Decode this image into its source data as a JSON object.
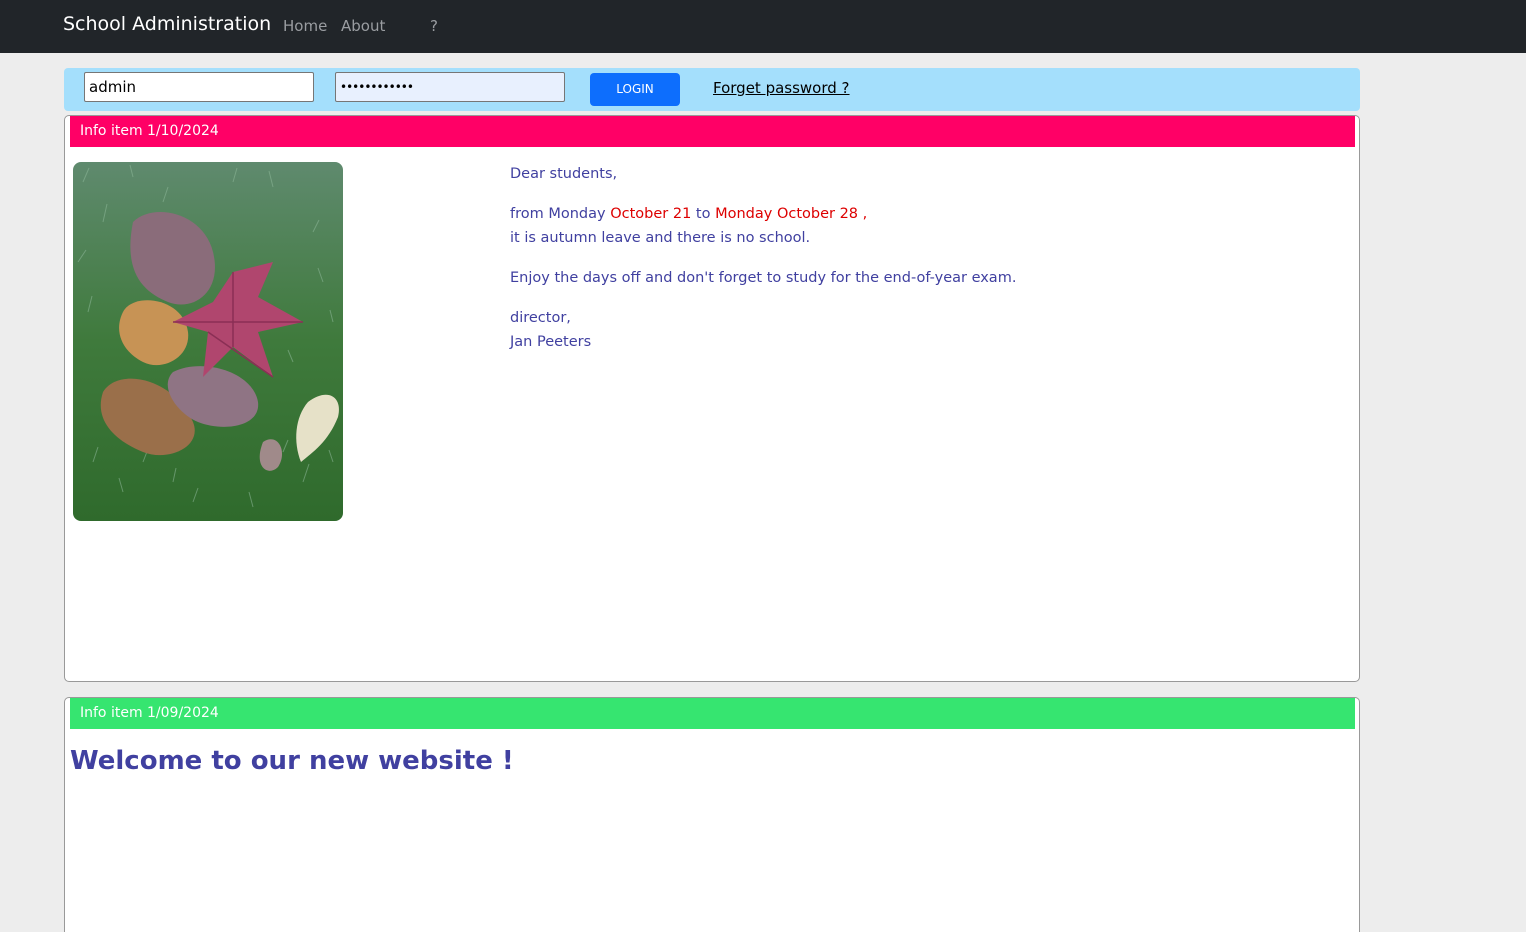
{
  "navbar": {
    "brand": "School Administration",
    "home": "Home",
    "about": "About",
    "help": "?"
  },
  "login": {
    "username_value": "admin",
    "password_mask": "••••••••••••",
    "login_label": "LOGIN",
    "forget_label": "Forget password ?"
  },
  "colors": {
    "navbar_bg": "#212529",
    "login_bar_bg": "#a4dffc",
    "login_button": "#0d6efd",
    "item1_header": "#ff0066",
    "item2_header": "#36e570",
    "text_blue": "#4040a0",
    "text_red": "#dd0000"
  },
  "items": [
    {
      "header": "Info item 1/10/2024",
      "greeting": "Dear students,",
      "line1_a": "from Monday",
      "line1_b": "October 21",
      "line1_c": "to",
      "line1_d": "Monday October 28",
      "line1_e": ",",
      "line2": "it is autumn leave and there is no school.",
      "line3": "Enjoy the days off and don't forget to study for the end-of-year exam.",
      "sign1": "director,",
      "sign2": "Jan Peeters"
    },
    {
      "header": "Info item 1/09/2024",
      "title": "Welcome to our new website !"
    }
  ]
}
